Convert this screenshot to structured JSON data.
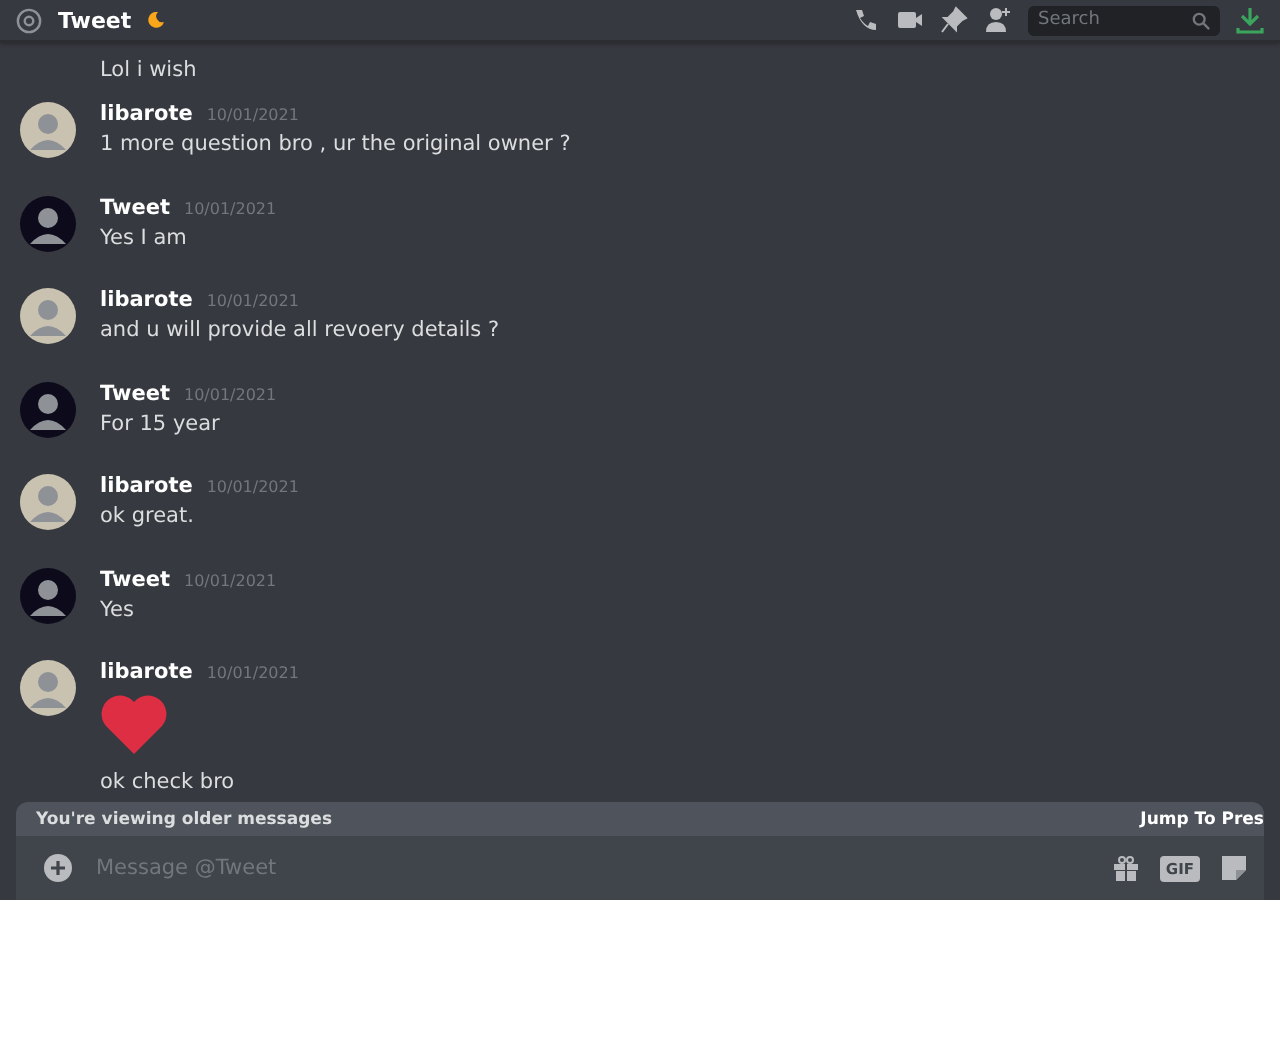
{
  "header": {
    "title": "Tweet",
    "search": {
      "placeholder": "Search"
    }
  },
  "messages": [
    {
      "kind": "continuation",
      "text": "Lol i wish"
    },
    {
      "kind": "group",
      "author": "libarote",
      "color": "#c9c2b0",
      "time": "10/01/2021",
      "lines": [
        "1 more question bro , ur the original owner ?"
      ]
    },
    {
      "kind": "group",
      "author": "Tweet",
      "color": "#0d0a1c",
      "time": "10/01/2021",
      "lines": [
        "Yes I am"
      ]
    },
    {
      "kind": "group",
      "author": "libarote",
      "color": "#c9c2b0",
      "time": "10/01/2021",
      "lines": [
        "and u will provide all revoery details ?"
      ]
    },
    {
      "kind": "group",
      "author": "Tweet",
      "color": "#0d0a1c",
      "time": "10/01/2021",
      "lines": [
        "For 15 year"
      ]
    },
    {
      "kind": "group",
      "author": "libarote",
      "color": "#c9c2b0",
      "time": "10/01/2021",
      "lines": [
        "ok great."
      ]
    },
    {
      "kind": "group",
      "author": "Tweet",
      "color": "#0d0a1c",
      "time": "10/01/2021",
      "lines": [
        "Yes"
      ]
    },
    {
      "kind": "group",
      "author": "libarote",
      "color": "#c9c2b0",
      "time": "10/01/2021",
      "heart": true,
      "lines": [
        "ok check bro"
      ]
    }
  ],
  "older_bar": {
    "text": "You're viewing older messages",
    "action": "Jump To Pres"
  },
  "composer": {
    "placeholder": "Message @Tweet",
    "gif": "GIF"
  }
}
